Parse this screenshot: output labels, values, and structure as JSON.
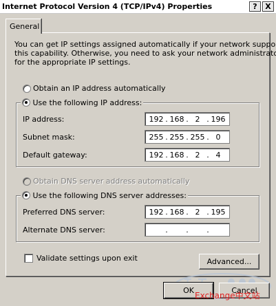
{
  "window": {
    "title": "Internet Protocol Version 4 (TCP/IPv4) Properties",
    "help_button": "?",
    "close_button": "X"
  },
  "tabs": [
    {
      "label": "General",
      "active": true
    }
  ],
  "description": [
    "You can get IP settings assigned automatically if your network supports",
    "this capability. Otherwise, you need to ask your network administrator",
    "for the appropriate IP settings."
  ],
  "ip_mode": {
    "auto_label": "Obtain an IP address automatically",
    "manual_label": "Use the following IP address:",
    "selected": "manual"
  },
  "ip_fields": [
    {
      "label": "IP address:",
      "octets": [
        "192",
        "168",
        "2",
        "196"
      ]
    },
    {
      "label": "Subnet mask:",
      "octets": [
        "255",
        "255",
        "255",
        "0"
      ]
    },
    {
      "label": "Default gateway:",
      "octets": [
        "192",
        "168",
        "2",
        "4"
      ]
    }
  ],
  "dns_mode": {
    "auto_label": "Obtain DNS server address automatically",
    "manual_label": "Use the following DNS server addresses:",
    "selected": "manual"
  },
  "dns_fields": [
    {
      "label": "Preferred DNS server:",
      "octets": [
        "192",
        "168",
        "2",
        "195"
      ]
    },
    {
      "label": "Alternate DNS server:",
      "octets": [
        "",
        "",
        "",
        ""
      ]
    }
  ],
  "validate": {
    "label": "Validate settings upon exit",
    "checked": false
  },
  "buttons": {
    "advanced": "Advanced...",
    "ok": "OK",
    "cancel": "Cancel"
  },
  "watermark": {
    "text": "Exchange中文站"
  }
}
